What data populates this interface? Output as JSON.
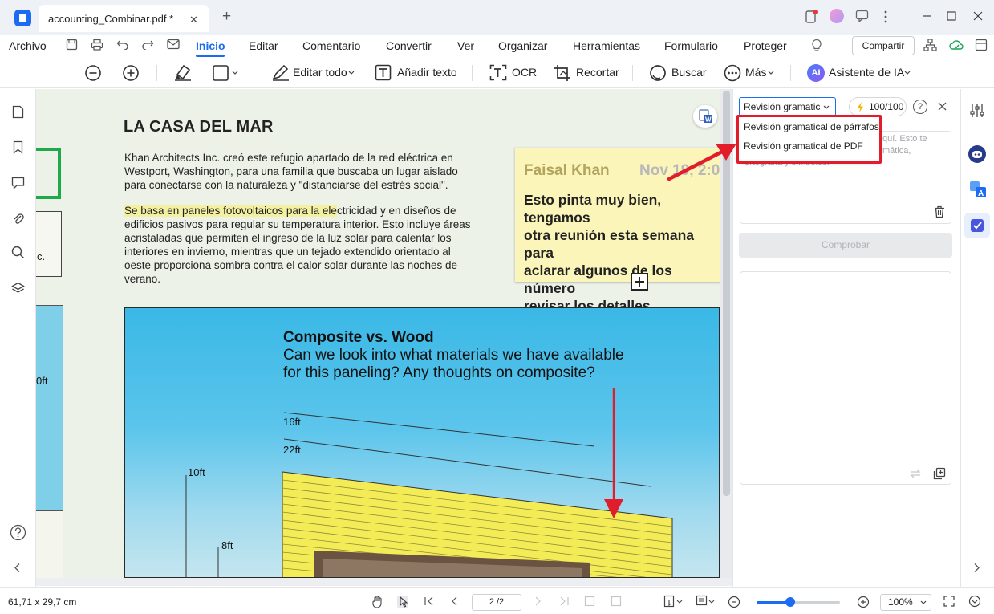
{
  "tab": {
    "title": "accounting_Combinar.pdf *",
    "close": "✕",
    "new_tab": "+"
  },
  "menu": {
    "file": "Archivo",
    "items": [
      "Inicio",
      "Editar",
      "Comentario",
      "Convertir",
      "Ver",
      "Organizar",
      "Herramientas",
      "Formulario",
      "Proteger"
    ],
    "active": "Inicio",
    "share": "Compartir"
  },
  "toolbar": {
    "edit_all": "Editar todo",
    "add_text": "Añadir texto",
    "ocr": "OCR",
    "crop": "Recortar",
    "search": "Buscar",
    "more": "Más",
    "ai_assistant": "Asistente de IA",
    "ai_badge": "AI"
  },
  "document": {
    "title": "LA CASA DEL MAR",
    "para1": [
      "Khan Architects Inc. creó este refugio apartado de la red eléctrica en",
      "Westport, Washington, para una familia que buscaba un lugar aislado",
      "para conectarse con la naturaleza y \"distanciarse del estrés social\"."
    ],
    "para2_highlight": "Se basa en paneles fotovoltaicos para la ele",
    "para2_rest_first": "ctricidad y en diseños de",
    "para2": [
      "edificios pasivos para regular su temperatura interior. Esto incluye áreas",
      "acristaladas que permiten el ingreso de la luz solar para calentar los",
      "interiores en invierno, mientras que un tejado extendido orientado al",
      "oeste proporciona sombra contra el calor solar durante las noches de",
      "verano."
    ],
    "left_fragments": {
      "c": "c.",
      "ft": "0ft"
    },
    "sticky": {
      "author": "Faisal Khan",
      "date": "Nov 19, 2:0",
      "text": "Esto pinta muy bien, tengamos\notra reunión esta semana para\naclarar algunos de los número\nrevisar los detalles."
    },
    "drawing": {
      "title": "Composite vs. Wood",
      "subtitle": "Can we look into what materials we have available\nfor this paneling? Any thoughts on composite?",
      "dimensions": [
        "16ft",
        "22ft",
        "10ft",
        "8ft"
      ]
    }
  },
  "panel": {
    "mode_select": "Revisión gramatic",
    "credits": "100/100",
    "help": "?",
    "dropdown": [
      "Revisión gramatical de párrafos",
      "Revisión gramatical de PDF"
    ],
    "placeholder_right": "quí. Esto te\nmática,",
    "placeholder_line": "ortografía y símbolos.",
    "check_button": "Comprobar"
  },
  "statusbar": {
    "dimensions": "61,71 x 29,7 cm",
    "page": "2 /2",
    "zoom": "100%",
    "zoom_level": 0.4
  },
  "colors": {
    "accent": "#1b6cf2",
    "annotation_red": "#e11d2b",
    "highlight": "#f3f0a0",
    "sticky": "#fbf5ba"
  }
}
